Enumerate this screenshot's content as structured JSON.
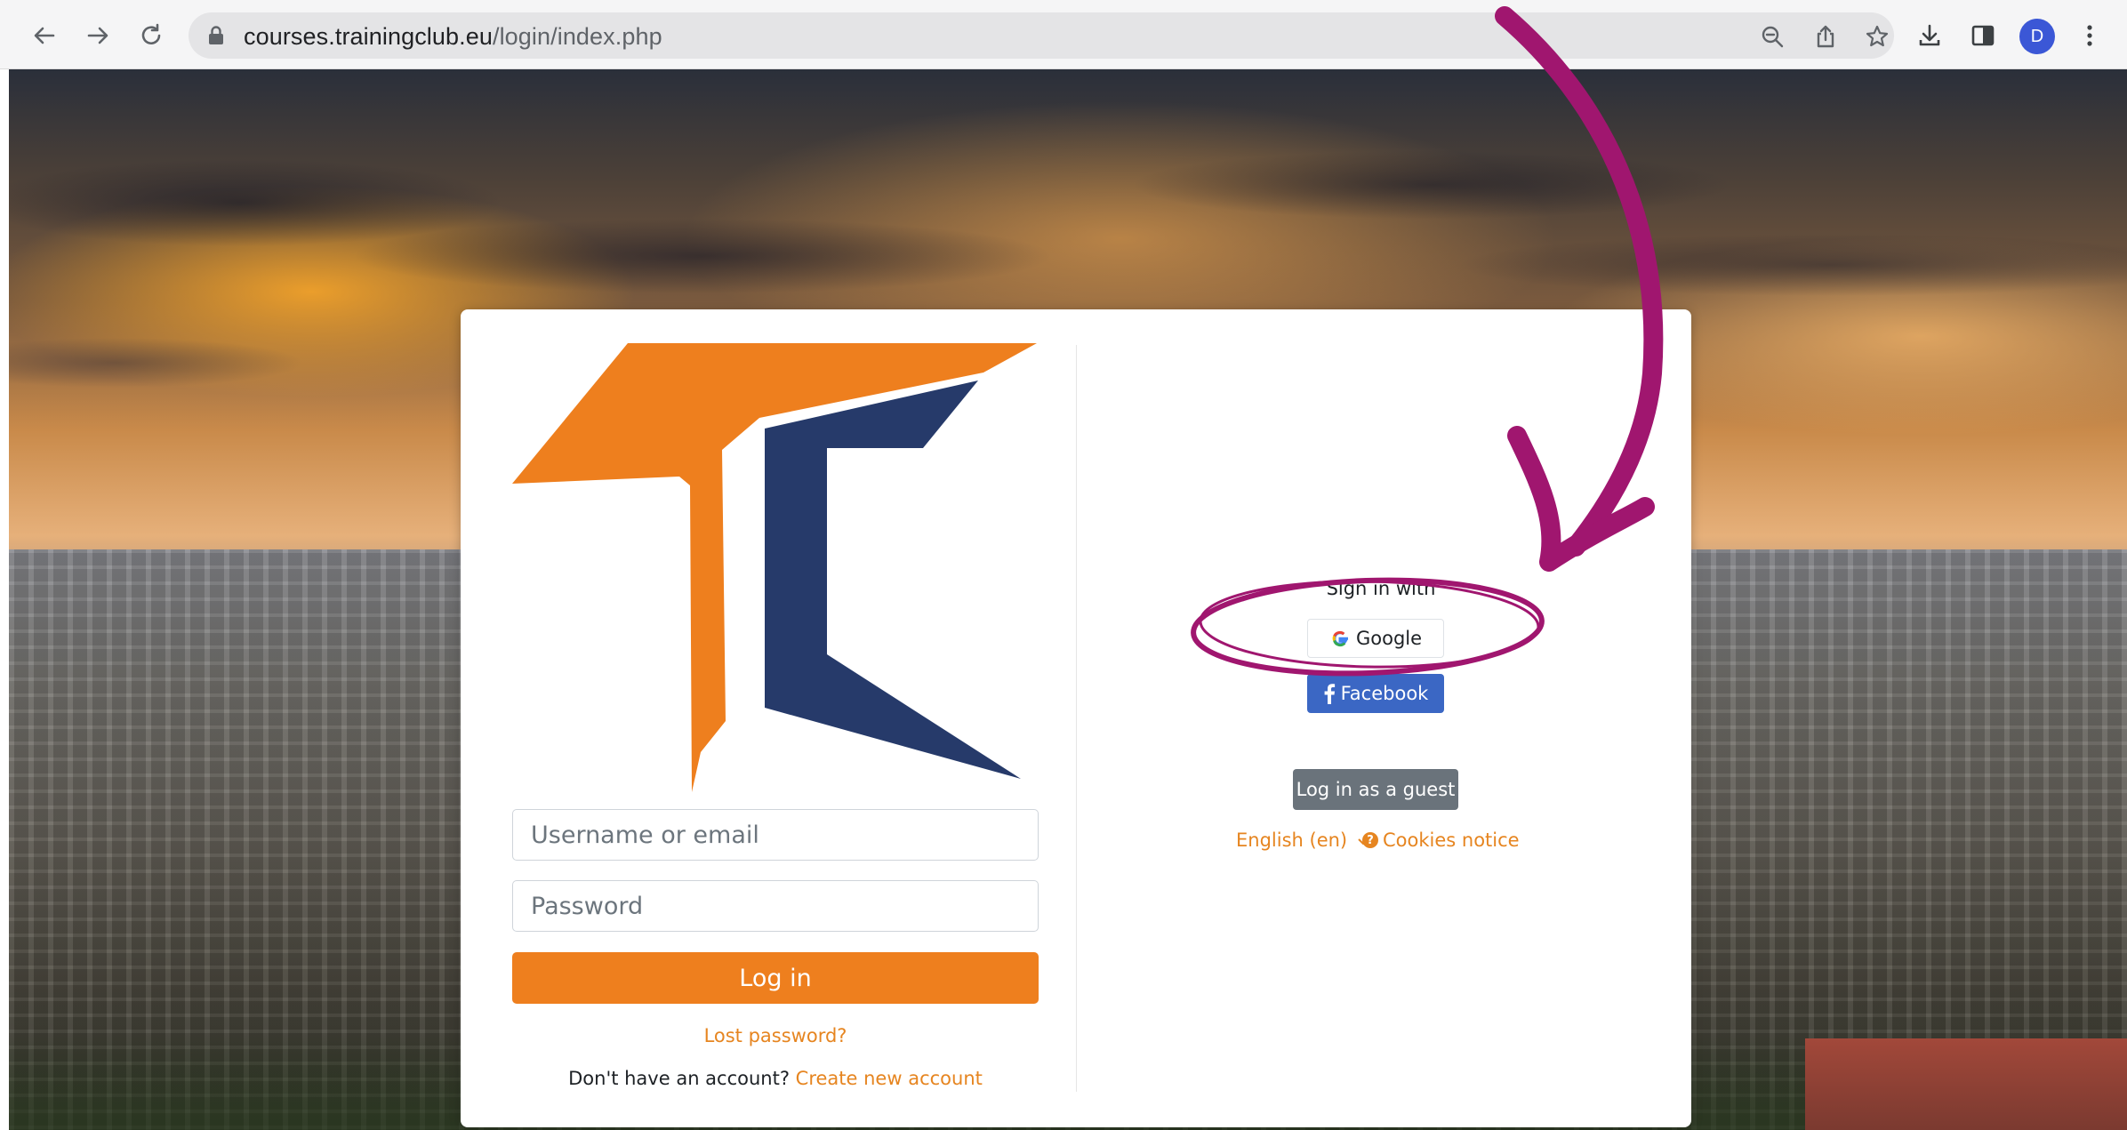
{
  "browser": {
    "url_host": "courses.trainingclub.eu",
    "url_path": "/login/index.php",
    "avatar_letter": "D",
    "icons": [
      "back-arrow-icon",
      "forward-arrow-icon",
      "reload-icon",
      "lock-icon",
      "zoom-out-icon",
      "share-icon",
      "star-icon",
      "download-icon",
      "side-panel-icon",
      "kebab-menu-icon"
    ]
  },
  "login": {
    "username_placeholder": "Username or email",
    "password_placeholder": "Password",
    "login_button": "Log in",
    "lost_password": "Lost password?",
    "no_account_text": "Don't have an account?",
    "create_account": "Create new account"
  },
  "oauth": {
    "sign_in_with": "Sign in with",
    "google": "Google",
    "facebook": "Facebook"
  },
  "guest_button": "Log in as a guest",
  "footer": {
    "language": "English (en)",
    "cookies": "Cookies notice"
  },
  "colors": {
    "brand_orange": "#ee7f1e",
    "brand_navy": "#263a6a",
    "facebook_blue": "#3b67c4",
    "guest_gray": "#6a737b",
    "annotation_magenta": "#a0166f"
  }
}
